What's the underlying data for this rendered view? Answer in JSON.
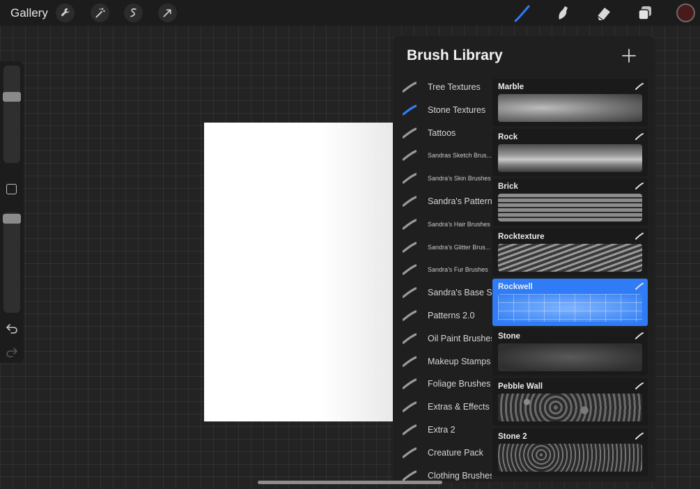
{
  "topbar": {
    "gallery_label": "Gallery",
    "left_tools": [
      "wrench-icon",
      "magic-wand-icon",
      "selection-icon",
      "transform-arrow-icon"
    ],
    "right_tools": [
      "brush-icon",
      "smudge-icon",
      "eraser-icon",
      "layers-icon"
    ],
    "active_tool": "brush-icon",
    "accent_color": "#2f7cf6",
    "current_color": "#4a1a1a"
  },
  "sidebar": {
    "brush_size_level": 0.66,
    "opacity_level": 0.98,
    "icons": [
      "modify-square-icon",
      "undo-icon",
      "redo-icon"
    ]
  },
  "library": {
    "title": "Brush Library",
    "add_icon": "plus-icon",
    "brush_sets": [
      {
        "label": "Tree Textures",
        "small": false,
        "active": false
      },
      {
        "label": "Stone Textures",
        "small": false,
        "active": true
      },
      {
        "label": "Tattoos",
        "small": false,
        "active": false
      },
      {
        "label": "Sandras Sketch Brus...",
        "small": true,
        "active": false
      },
      {
        "label": "Sandra's Skin Brushes",
        "small": true,
        "active": false
      },
      {
        "label": "Sandra's Patterns",
        "small": false,
        "active": false
      },
      {
        "label": "Sandra's Hair Brushes",
        "small": true,
        "active": false
      },
      {
        "label": "Sandra's Glitter Brus...",
        "small": true,
        "active": false
      },
      {
        "label": "Sandra's Fur Brushes",
        "small": true,
        "active": false
      },
      {
        "label": "Sandra's Base Set",
        "small": false,
        "active": false
      },
      {
        "label": "Patterns 2.0",
        "small": false,
        "active": false
      },
      {
        "label": "Oil Paint Brushes",
        "small": false,
        "active": false
      },
      {
        "label": "Makeup Stamps",
        "small": false,
        "active": false
      },
      {
        "label": "Foliage Brushes",
        "small": false,
        "active": false
      },
      {
        "label": "Extras & Effects",
        "small": false,
        "active": false
      },
      {
        "label": "Extra 2",
        "small": false,
        "active": false
      },
      {
        "label": "Creature Pack",
        "small": false,
        "active": false
      },
      {
        "label": "Clothing Brushes",
        "small": false,
        "active": false
      }
    ],
    "brushes": [
      {
        "name": "Marble",
        "selected": false
      },
      {
        "name": "Rock",
        "selected": false
      },
      {
        "name": "Brick",
        "selected": false
      },
      {
        "name": "Rocktexture",
        "selected": false
      },
      {
        "name": "Rockwell",
        "selected": true
      },
      {
        "name": "Stone",
        "selected": false
      },
      {
        "name": "Pebble Wall",
        "selected": false
      },
      {
        "name": "Stone 2",
        "selected": false
      }
    ]
  }
}
